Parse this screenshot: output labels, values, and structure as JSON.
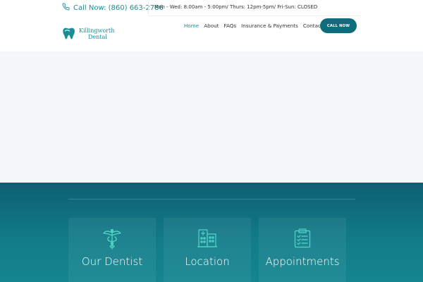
{
  "topbar": {
    "phone_label": "Call Now: (860) 663-2786",
    "hours": "Mon - Wed: 8:00am - 5:00pm/ Thurs: 12pm-5pm/ Fri-Sun: CLOSED"
  },
  "logo": {
    "line1": "Killingworth",
    "line2": "Dental"
  },
  "nav": {
    "items": [
      {
        "label": "Home",
        "active": true
      },
      {
        "label": "About"
      },
      {
        "label": "FAQs"
      },
      {
        "label": "Insurance & Payments"
      },
      {
        "label": "Contact"
      }
    ],
    "cta": "CALL NOW"
  },
  "services": {
    "cards": [
      {
        "title": "Our Dentist",
        "icon": "caduceus-icon"
      },
      {
        "title": "Location",
        "icon": "building-icon"
      },
      {
        "title": "Appointments",
        "icon": "clipboard-icon"
      }
    ]
  },
  "colors": {
    "accent": "#1a8e94",
    "button": "#0f6c7c",
    "icon": "#4fd8c8",
    "band_top": "#0d5f72",
    "band_bottom": "#148590"
  }
}
